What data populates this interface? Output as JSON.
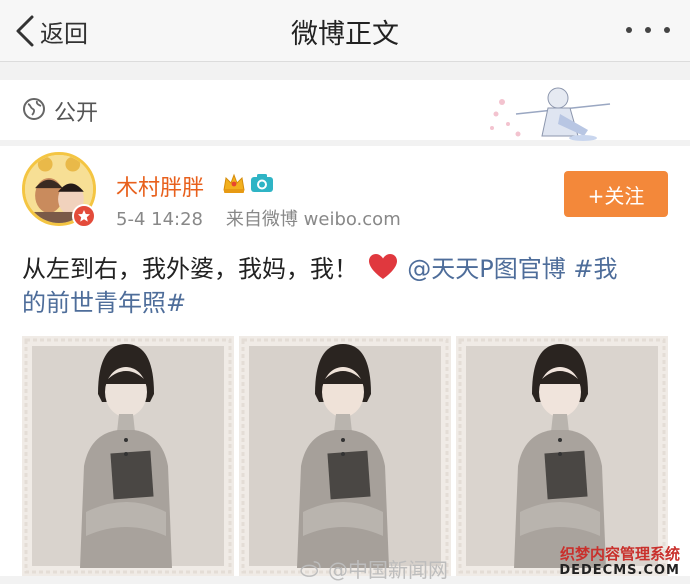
{
  "nav": {
    "back_label": "返回",
    "title": "微博正文",
    "more_icon": "more-dots-icon"
  },
  "visibility": {
    "label": "公开",
    "icon": "globe-icon"
  },
  "post": {
    "username": "木村胖胖",
    "time": "5-4 14:28",
    "source": "来自微博 weibo.com",
    "follow_label": "+关注",
    "text_plain": "从左到右，我外婆，我妈，我！",
    "mention": "@天天P图官博",
    "hashtag_1": "#我",
    "hashtag_2": "的前世青年照#",
    "photos": [
      "photo-1",
      "photo-2",
      "photo-3"
    ]
  },
  "watermark": {
    "weibo": "@中国新闻网",
    "cms_line1": "织梦内容管理系统",
    "cms_line2": "DEDECMS.COM"
  },
  "colors": {
    "username": "#e8601c",
    "follow_bg": "#f3883a",
    "link": "#4e6d9a",
    "heart": "#e0383e"
  }
}
